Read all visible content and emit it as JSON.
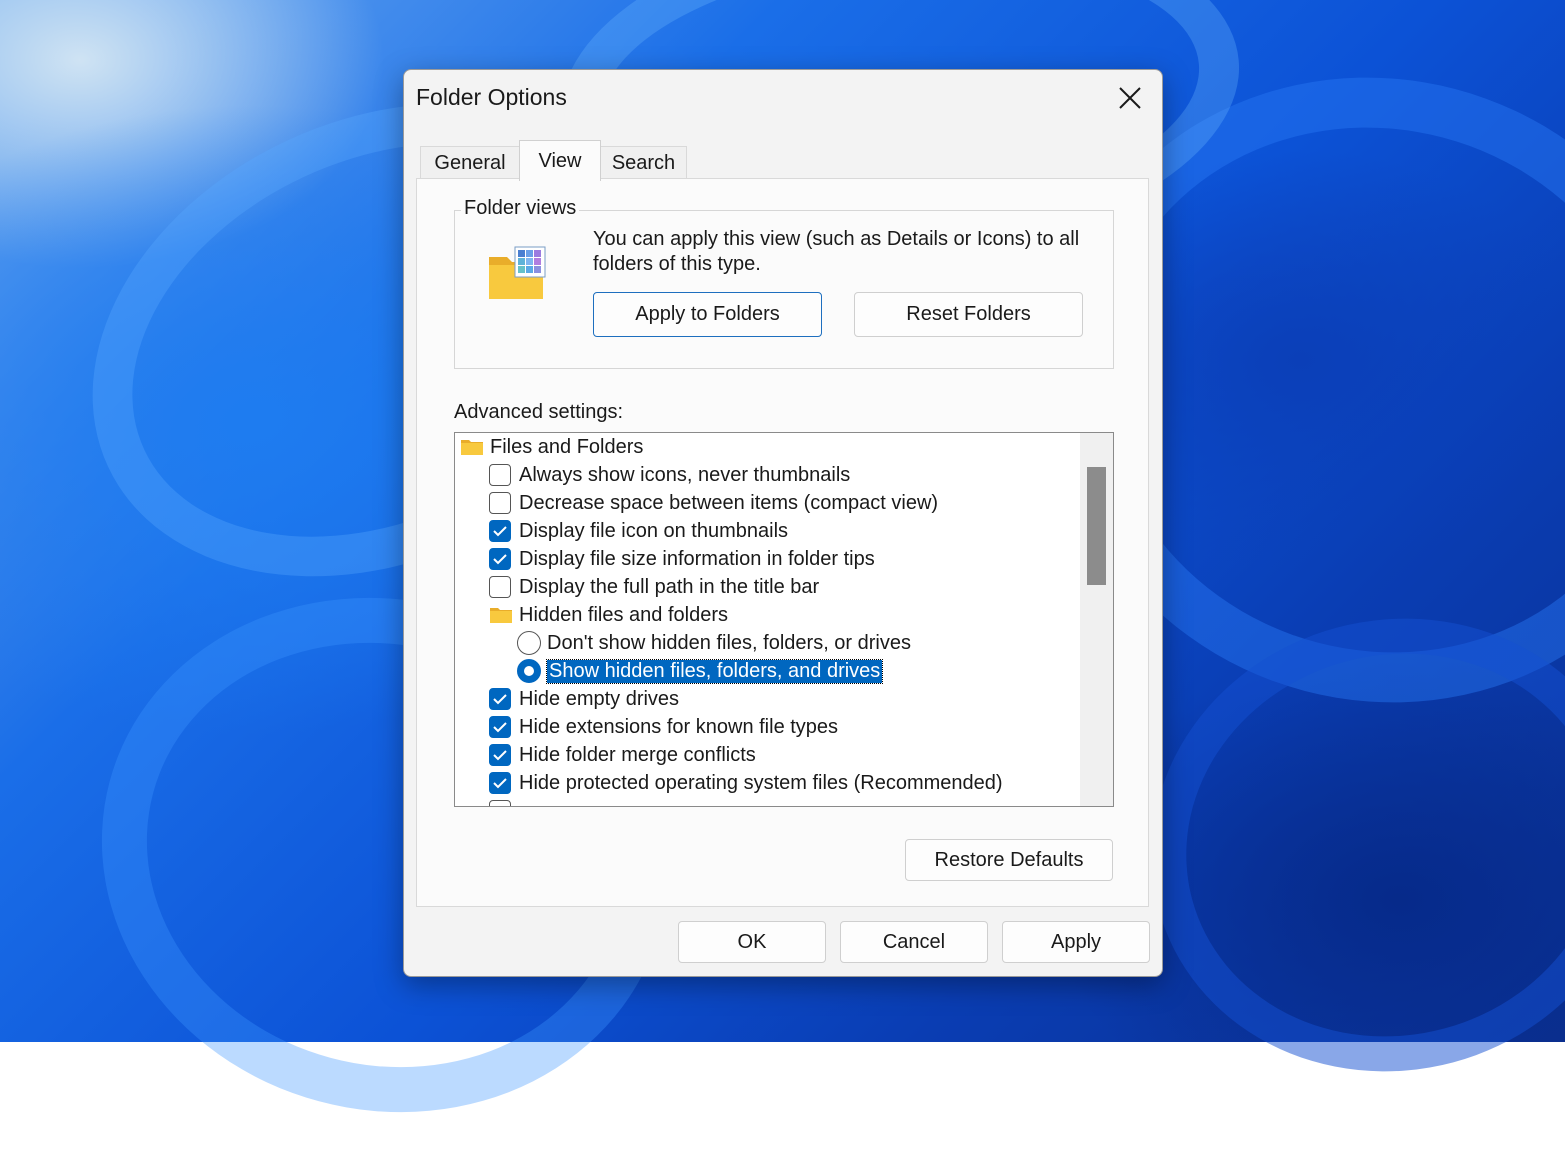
{
  "dialog": {
    "title": "Folder Options",
    "tabs": [
      {
        "label": "General"
      },
      {
        "label": "View"
      },
      {
        "label": "Search"
      }
    ]
  },
  "folder_views": {
    "group_label": "Folder views",
    "description": "You can apply this view (such as Details or Icons) to all folders of this type.",
    "apply_button": "Apply to Folders",
    "reset_button": "Reset Folders"
  },
  "advanced": {
    "label": "Advanced settings:",
    "root_label": "Files and Folders",
    "items": [
      {
        "label": "Always show icons, never thumbnails",
        "checked": false
      },
      {
        "label": "Decrease space between items (compact view)",
        "checked": false
      },
      {
        "label": "Display file icon on thumbnails",
        "checked": true
      },
      {
        "label": "Display file size information in folder tips",
        "checked": true
      },
      {
        "label": "Display the full path in the title bar",
        "checked": false
      }
    ],
    "hidden_group_label": "Hidden files and folders",
    "hidden_options": [
      {
        "label": "Don't show hidden files, folders, or drives",
        "selected": false
      },
      {
        "label": "Show hidden files, folders, and drives",
        "selected": true
      }
    ],
    "items_after": [
      {
        "label": "Hide empty drives",
        "checked": true
      },
      {
        "label": "Hide extensions for known file types",
        "checked": true
      },
      {
        "label": "Hide folder merge conflicts",
        "checked": true
      },
      {
        "label": "Hide protected operating system files (Recommended)",
        "checked": true
      }
    ],
    "restore_button": "Restore Defaults"
  },
  "footer": {
    "ok": "OK",
    "cancel": "Cancel",
    "apply": "Apply"
  },
  "colors": {
    "accent": "#0067c0",
    "folder": "#f8c93e"
  }
}
